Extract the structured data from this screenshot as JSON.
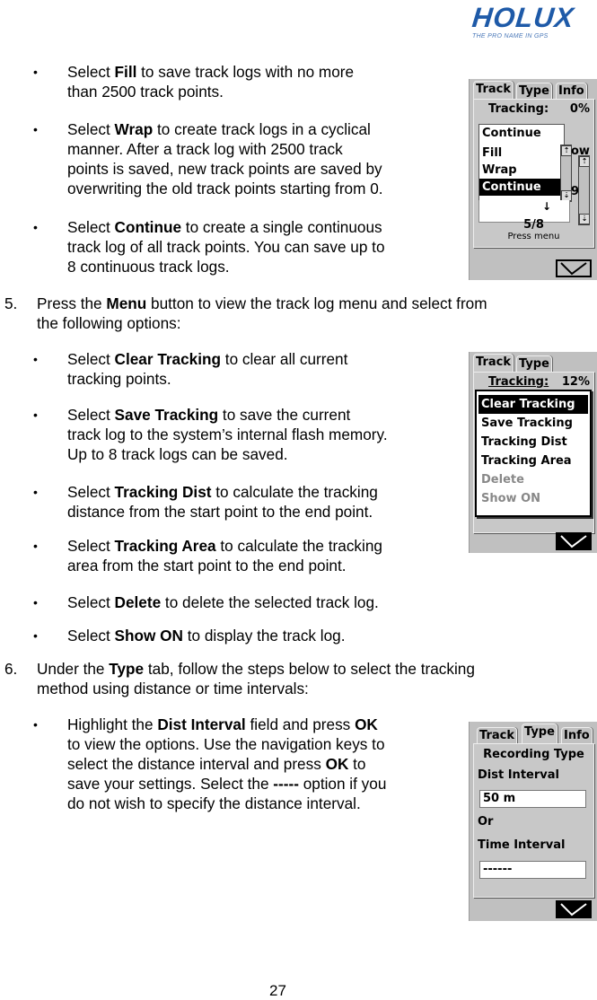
{
  "logo": {
    "brand": "HOLUX",
    "tagline": "THE PRO NAME IN GPS",
    "color": "#1e5aa8"
  },
  "section1": {
    "bullets": [
      {
        "pre": "Select ",
        "bold": "Fill",
        "post_lines": [
          " to save track logs with no more",
          "than 2500 track points."
        ]
      },
      {
        "pre": "Select ",
        "bold": "Wrap",
        "post_lines": [
          " to create track logs in a cyclical",
          "manner. After a track log with 2500 track",
          "points is saved, new track points are saved by",
          "overwriting the old track points starting from 0."
        ]
      },
      {
        "pre": "Select ",
        "bold": "Continue",
        "post_lines": [
          " to create a single continuous",
          "track log of all track points. You can save up to",
          "8 continuous track logs."
        ]
      }
    ]
  },
  "step5": {
    "number": "5.",
    "pre": "Press the ",
    "bold": "Menu",
    "post": " button to view the track log menu and select from",
    "line2": "the following options:",
    "bullets": [
      {
        "pre": "Select ",
        "bold": "Clear Tracking",
        "post": " to clear all current",
        "cont": [
          "tracking points."
        ]
      },
      {
        "pre": "Select ",
        "bold": "Save Tracking",
        "post": " to save the current",
        "cont": [
          "track log to the system’s internal flash memory.",
          "Up to 8 track logs can be saved."
        ]
      },
      {
        "pre": "Select ",
        "bold": "Tracking Dist",
        "post": " to calculate the tracking",
        "cont": [
          "distance from the start point to the end point."
        ]
      },
      {
        "pre": "Select ",
        "bold": "Tracking Area",
        "post": " to calculate the tracking",
        "cont": [
          "area from the start point to the end point."
        ]
      },
      {
        "pre": "Select ",
        "bold": "Delete",
        "post": " to delete the selected track log.",
        "cont": []
      },
      {
        "pre": "Select ",
        "bold": "Show ON",
        "post": " to display the track log.",
        "cont": []
      }
    ]
  },
  "step6": {
    "number": "6.",
    "pre": "Under the ",
    "bold": "Type",
    "post": " tab, follow the steps below to select the tracking",
    "line2": "method using distance or time intervals:",
    "bullet": {
      "l1_pre": "Highlight the ",
      "l1_bold": "Dist Interval",
      "l1_mid": " field and press ",
      "l1_bold2": "OK",
      "l2": "to view the options. Use the navigation keys to",
      "l3_pre": "select the distance interval and press ",
      "l3_bold": "OK",
      "l3_post": " to",
      "l4_pre": "save your settings. Select the ",
      "l4_bold": "-----",
      "l4_post": " option if you",
      "l5": "do not wish to specify the distance interval."
    }
  },
  "screen1": {
    "tabs": [
      "Track",
      "Type",
      "Info"
    ],
    "tracking_label": "Tracking:",
    "tracking_value": "0%",
    "dropdown_value": "Continue",
    "options": [
      "Fill",
      "Wrap",
      "Continue"
    ],
    "selected_option": "Continue",
    "partial_label": "ow",
    "partial_digit": "9",
    "count": "5/8",
    "hint": "Press menu"
  },
  "screen2": {
    "tabs": [
      "Track",
      "Type"
    ],
    "tracking_label": "Tracking:",
    "tracking_value": "12%",
    "menu_items": [
      {
        "label": "Clear Tracking",
        "state": "selected"
      },
      {
        "label": "Save Tracking",
        "state": "normal"
      },
      {
        "label": "Tracking Dist",
        "state": "normal"
      },
      {
        "label": "Tracking Area",
        "state": "normal"
      },
      {
        "label": "Delete",
        "state": "disabled"
      },
      {
        "label": "Show ON",
        "state": "disabled"
      }
    ]
  },
  "screen3": {
    "tabs": [
      "Track",
      "Type",
      "Info"
    ],
    "heading": "Recording Type",
    "dist_label": "Dist Interval",
    "dist_value": "50 m",
    "or_label": "Or",
    "time_label": "Time Interval",
    "time_value": "------"
  },
  "page_number": "27"
}
